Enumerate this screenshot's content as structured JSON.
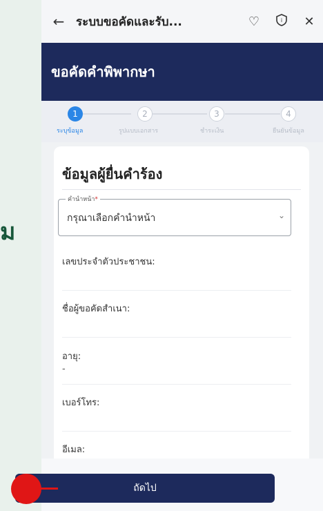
{
  "browser": {
    "title": "ระบบขอคัดและรับ..."
  },
  "header": {
    "title": "ขอคัดคำพิพากษา"
  },
  "stepper": {
    "steps": [
      {
        "num": "1",
        "label": "ระบุข้อมูล"
      },
      {
        "num": "2",
        "label": "รูปแบบเอกสาร"
      },
      {
        "num": "3",
        "label": "ชำระเงิน"
      },
      {
        "num": "4",
        "label": "ยืนยันข้อมูล"
      }
    ]
  },
  "form": {
    "title": "ข้อมูลผู้ยื่นคำร้อง",
    "prefix_label": "คำนำหน้า",
    "prefix_required": "*",
    "prefix_value": "กรุณาเลือกคำนำหน้า",
    "id_label": "เลขประจำตัวประชาชน:",
    "name_label": "ชื่อผู้ขอคัดสำเนา:",
    "age_label": "อายุ:",
    "age_value": "-",
    "phone_label": "เบอร์โทร:",
    "email_label": "อีเมล:"
  },
  "footer": {
    "next_label": "ถัดไป"
  },
  "background": {
    "glyph": "ม"
  },
  "colors": {
    "primary": "#1d2a5c",
    "accent": "#2b86e6",
    "marker": "#e01616"
  }
}
